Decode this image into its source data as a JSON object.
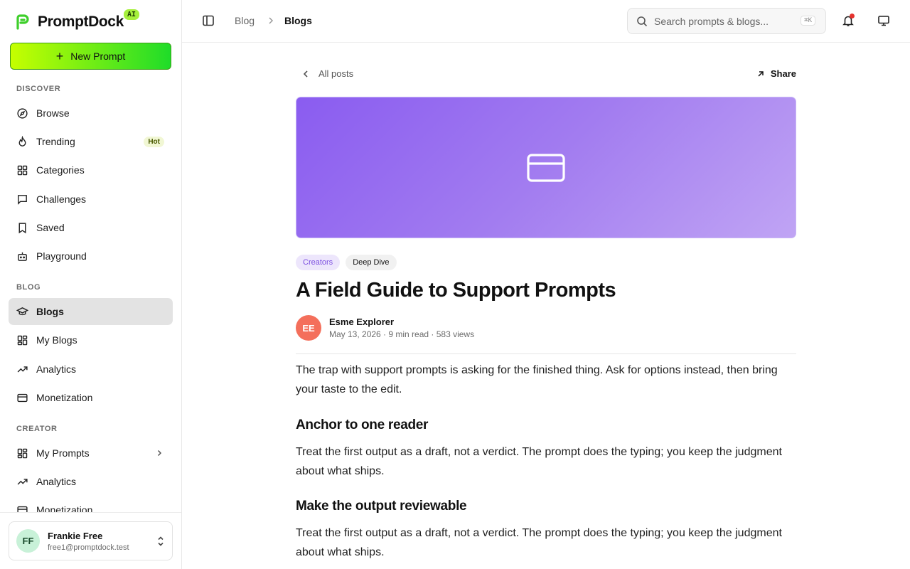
{
  "brand": {
    "name": "PromptDock",
    "badge": "AI"
  },
  "new_prompt_label": "New Prompt",
  "sidebar": {
    "discover_label": "DISCOVER",
    "discover": [
      {
        "label": "Browse",
        "icon": "compass-icon"
      },
      {
        "label": "Trending",
        "icon": "flame-icon",
        "badge": "Hot"
      },
      {
        "label": "Categories",
        "icon": "grid-icon"
      },
      {
        "label": "Challenges",
        "icon": "message-square-icon"
      },
      {
        "label": "Saved",
        "icon": "bookmark-icon"
      },
      {
        "label": "Playground",
        "icon": "bot-icon"
      }
    ],
    "blog_label": "BLOG",
    "blog": [
      {
        "label": "Blogs",
        "icon": "graduation-cap-icon",
        "active": true
      },
      {
        "label": "My Blogs",
        "icon": "layout-grid-icon"
      },
      {
        "label": "Analytics",
        "icon": "trending-up-icon"
      },
      {
        "label": "Monetization",
        "icon": "credit-card-icon"
      }
    ],
    "creator_label": "CREATOR",
    "creator": [
      {
        "label": "My Prompts",
        "icon": "layout-grid-icon"
      },
      {
        "label": "Analytics",
        "icon": "trending-up-icon"
      },
      {
        "label": "Monetization",
        "icon": "credit-card-icon"
      }
    ]
  },
  "user": {
    "initials": "FF",
    "name": "Frankie Free",
    "email": "free1@promptdock.test"
  },
  "topbar": {
    "breadcrumb_parent": "Blog",
    "breadcrumb_current": "Blogs",
    "search_placeholder": "Search prompts & blogs...",
    "search_shortcut": "⌘K"
  },
  "article": {
    "back_label": "All posts",
    "share_label": "Share",
    "tags": [
      "Creators",
      "Deep Dive"
    ],
    "title": "A Field Guide to Support Prompts",
    "author": {
      "initials": "EE",
      "name": "Esme Explorer",
      "meta": "May 13, 2026 · 9 min read · 583 views"
    },
    "intro": "The trap with support prompts is asking for the finished thing. Ask for options instead, then bring your taste to the edit.",
    "sections": [
      {
        "heading": "Anchor to one reader",
        "body": "Treat the first output as a draft, not a verdict. The prompt does the typing; you keep the judgment about what ships."
      },
      {
        "heading": "Make the output reviewable",
        "body": "Treat the first output as a draft, not a verdict. The prompt does the typing; you keep the judgment about what ships."
      }
    ]
  },
  "colors": {
    "accent_green": "#1fdc29",
    "accent_lime": "#c6ff00",
    "hero_purple": "#8a5cf0",
    "tag_purple": "#7c4fe0",
    "author_avatar": "#f46f5b"
  }
}
